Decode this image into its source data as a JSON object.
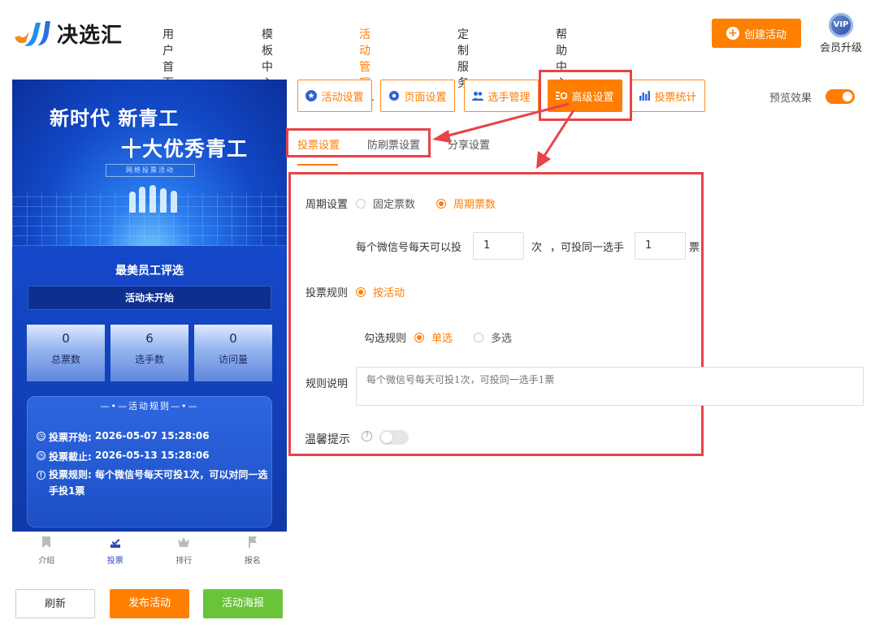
{
  "header": {
    "logo_text": "决选汇",
    "nav": [
      "用户首页",
      "模板中心",
      "活动管理",
      "定制服务",
      "帮助中心"
    ],
    "active_nav": "活动管理",
    "create_label": "创建活动",
    "vip_badge": "VIP",
    "vip_label": "会员升级"
  },
  "preview": {
    "banner_line1": "新时代 新青工",
    "banner_line2": "十大优秀青工",
    "banner_tag": "网络投票活动",
    "title": "最美员工评选",
    "status": "活动未开始",
    "stats": [
      {
        "value": "0",
        "label": "总票数"
      },
      {
        "value": "6",
        "label": "选手数"
      },
      {
        "value": "0",
        "label": "访问量"
      }
    ],
    "rules_title": "活动规则",
    "rules": [
      {
        "label": "投票开始:",
        "value": "2026-05-07 15:28:06"
      },
      {
        "label": "投票截止:",
        "value": "2026-05-13 15:28:06"
      },
      {
        "label": "投票规则:",
        "value": "每个微信号每天可投1次，可以对同一选手投1票"
      }
    ],
    "tabs": [
      "介绍",
      "投票",
      "排行",
      "报名"
    ],
    "active_tab": "投票"
  },
  "actions": {
    "refresh": "刷新",
    "publish": "发布活动",
    "poster": "活动海报"
  },
  "toolbar": {
    "buttons": [
      "活动设置",
      "页面设置",
      "选手管理",
      "高级设置",
      "投票统计"
    ],
    "active": "高级设置",
    "preview_label": "预览效果",
    "preview_on": true
  },
  "subtabs": {
    "items": [
      "投票设置",
      "防刷票设置",
      "分享设置"
    ],
    "active": "投票设置"
  },
  "form": {
    "cycle_label": "周期设置",
    "cycle_options": [
      "固定票数",
      "周期票数"
    ],
    "cycle_selected": "周期票数",
    "per_day_label": "每个微信号每天可以投",
    "per_day_value": "1",
    "times_unit": "次",
    "same_player_label": "，可投同一选手",
    "same_player_value": "1",
    "votes_unit": "票",
    "rule_label": "投票规则",
    "rule_option": "按活动",
    "check_label": "勾选规则",
    "check_options": [
      "单选",
      "多选"
    ],
    "check_selected": "单选",
    "desc_label": "规则说明",
    "desc_placeholder": "每个微信号每天可投1次，可投同一选手1票",
    "tip_label": "温馨提示",
    "tip_help": "?",
    "tip_on": false
  },
  "colors": {
    "accent": "#ff7d00",
    "highlight": "#e8424a",
    "poster_green": "#6ac43a"
  }
}
